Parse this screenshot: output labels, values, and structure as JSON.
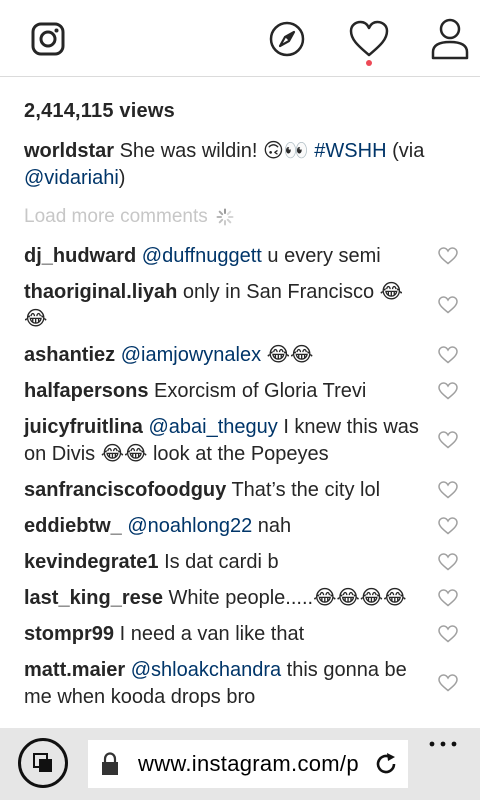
{
  "nav": {
    "icons": [
      "instagram-logo-icon",
      "explore-compass-icon",
      "activity-heart-icon",
      "profile-icon"
    ],
    "notification_color": "#ed4956"
  },
  "post": {
    "views": "2,414,115 views",
    "caption": {
      "user": "worldstar",
      "text": " She was wildin! 🙃👀 ",
      "hashtag": "#WSHH",
      "via": " (via ",
      "mention": "@vidariahi",
      "close": ")"
    },
    "load_more": "Load more comments"
  },
  "comments": [
    {
      "user": "dj_hudward",
      "mention": "@duffnuggett",
      "text": " u every semi"
    },
    {
      "user": "thaoriginal.liyah",
      "mention": "",
      "text": " only in San Francisco 😂😂"
    },
    {
      "user": "ashantiez",
      "mention": "@iamjowynalex",
      "text": " 😂😂"
    },
    {
      "user": "halfapersons",
      "mention": "",
      "text": " Exorcism of Gloria Trevi"
    },
    {
      "user": "juicyfruitlina",
      "mention": "@abai_theguy",
      "text": " I knew this was on Divis 😂😂 look at the Popeyes"
    },
    {
      "user": "sanfranciscofoodguy",
      "mention": "",
      "text": " That’s the city lol"
    },
    {
      "user": "eddiebtw_",
      "mention": "@noahlong22",
      "text": " nah"
    },
    {
      "user": "kevindegrate1",
      "mention": "",
      "text": " Is dat cardi b"
    },
    {
      "user": "last_king_rese",
      "mention": "",
      "text": " White people.....😂😂😂😂"
    },
    {
      "user": "stompr99",
      "mention": "",
      "text": " I need a van like that"
    },
    {
      "user": "matt.maier",
      "mention": "@shloakchandra",
      "text": " this gonna be me when kooda drops bro"
    }
  ],
  "browser": {
    "url": "www.instagram.com/p",
    "icons": [
      "tabs-icon",
      "lock-icon",
      "reload-icon",
      "more-icon"
    ]
  }
}
